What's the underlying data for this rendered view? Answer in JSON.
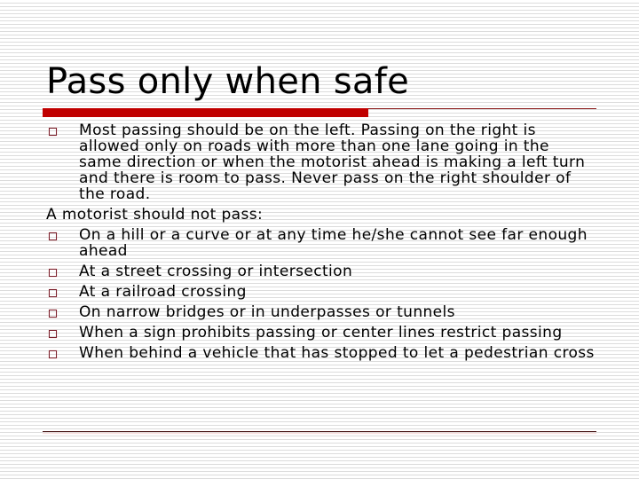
{
  "slide": {
    "title": "Pass only when safe",
    "accent_color": "#c00000",
    "bullet_icon": "hollow-square",
    "content": {
      "intro_item": "Most passing should be on the left. Passing on the right is allowed only on roads with more than one lane going in the same direction or when the motorist ahead is making a left turn and there is room to pass. Never pass on the right shoulder of the road.",
      "lead_in": "A motorist should not pass:",
      "items": [
        "On a hill or a curve or at any time he/she cannot see far enough ahead",
        "At a street crossing or intersection",
        "At a railroad crossing",
        "On narrow bridges or in underpasses or tunnels",
        "When a sign prohibits passing or center lines restrict passing",
        "When behind a vehicle that has stopped to let a pedestrian cross"
      ]
    }
  }
}
